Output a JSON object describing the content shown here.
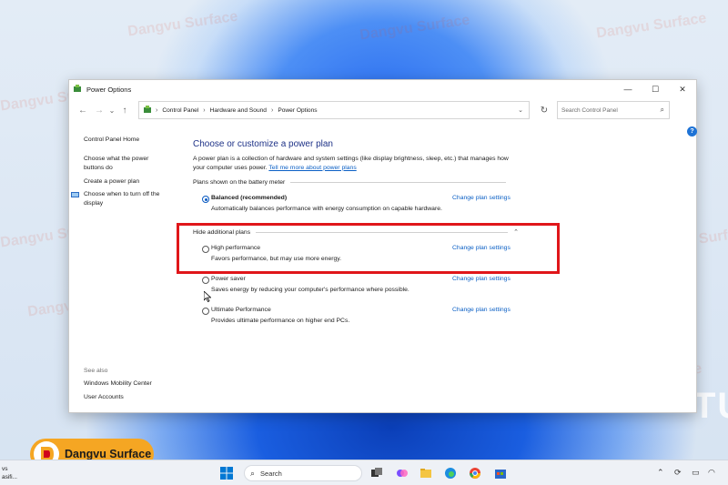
{
  "window": {
    "title": "Power Options",
    "controls": {
      "minimize": "—",
      "maximize": "☐",
      "close": "✕"
    }
  },
  "nav": {
    "back": "←",
    "forward": "→",
    "recent": "⌄",
    "up": "↑",
    "breadcrumb": [
      "Control Panel",
      "Hardware and Sound",
      "Power Options"
    ],
    "search_placeholder": "Search Control Panel"
  },
  "sidebar": {
    "home": "Control Panel Home",
    "items": [
      "Choose what the power buttons do",
      "Create a power plan",
      "Choose when to turn off the display"
    ],
    "see_also": {
      "heading": "See also",
      "items": [
        "Windows Mobility Center",
        "User Accounts"
      ]
    }
  },
  "main": {
    "heading": "Choose or customize a power plan",
    "description": "A power plan is a collection of hardware and system settings (like display brightness, sleep, etc.) that manages how your computer uses power.",
    "description_link": "Tell me more about power plans",
    "battery_section": "Plans shown on the battery meter",
    "hide_section": "Hide additional plans",
    "change_link": "Change plan settings",
    "plans": [
      {
        "name": "Balanced (recommended)",
        "description": "Automatically balances performance with energy consumption on capable hardware.",
        "selected": true
      },
      {
        "name": "High performance",
        "description": "Favors performance, but may use more energy.",
        "selected": false
      },
      {
        "name": "Power saver",
        "description": "Saves energy by reducing your computer's performance where possible.",
        "selected": false
      },
      {
        "name": "Ultimate Performance",
        "description": "Provides ultimate performance on higher end PCs.",
        "selected": false
      }
    ]
  },
  "watermark": {
    "brand": "Dangvu Surface"
  },
  "desktop": {
    "partial_text": "TU"
  },
  "taskbar": {
    "left_text_1": "vs",
    "left_text_2": "asifi...",
    "search_label": "Search"
  },
  "colors": {
    "accent": "#0a5fc5",
    "heading": "#1e3287",
    "highlight_box": "#e0161a",
    "logo_badge": "#f5a623"
  },
  "icons": [
    "shield-icon",
    "help-icon",
    "windows-logo-icon",
    "search-icon",
    "refresh-icon",
    "chevron-up-icon",
    "chevron-down-icon"
  ]
}
